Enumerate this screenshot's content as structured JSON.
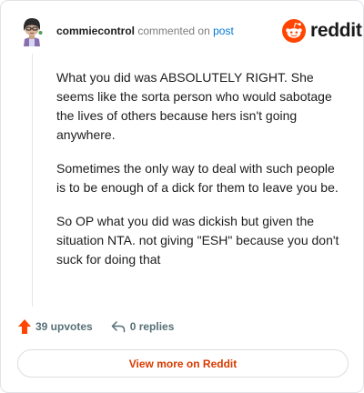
{
  "comment": {
    "author": "commiecontrol",
    "action_text": "commented on",
    "post_link_label": "post",
    "paragraphs": [
      "What you did was ABSOLUTELY RIGHT. She seems like the sorta person who would sabotage the lives of others because hers isn't going anywhere.",
      "Sometimes the only way to deal with such people is to be enough of a dick for them to leave you be.",
      "So OP what you did was dickish but given the situation NTA. not giving \"ESH\" because you don't suck for doing that"
    ]
  },
  "brand": {
    "name": "reddit",
    "color": "#ff4500"
  },
  "actions": {
    "upvotes_label": "39 upvotes",
    "replies_label": "0 replies",
    "upvote_color": "#ff4500"
  },
  "footer": {
    "view_more_label": "View more on Reddit"
  },
  "icons": {
    "avatar": "avatar-icon",
    "logo": "reddit-alien-icon",
    "upvote": "upvote-arrow-icon",
    "reply": "reply-arrow-icon"
  }
}
